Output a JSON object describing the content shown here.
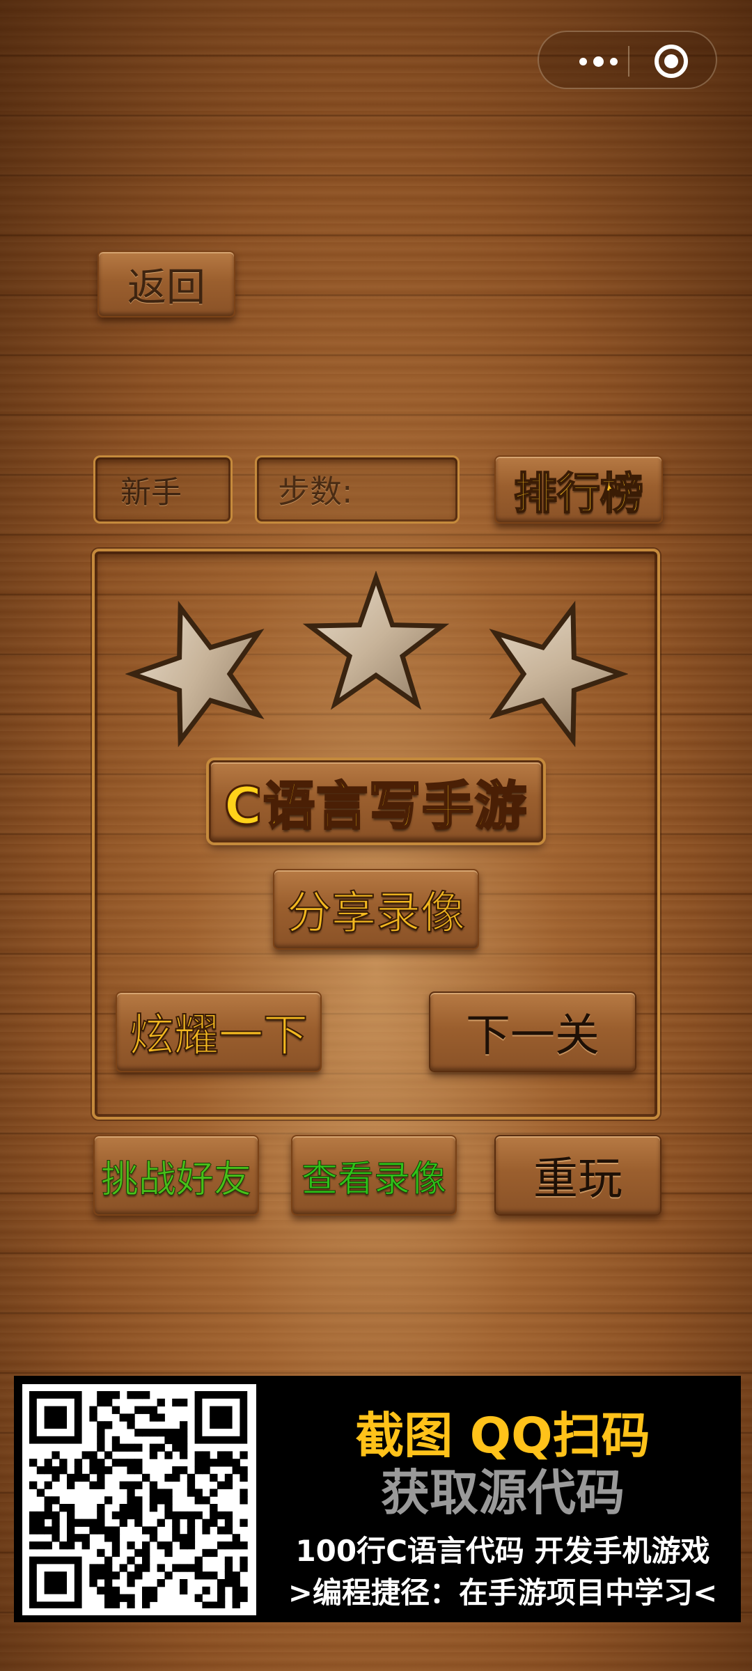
{
  "capsule": {
    "more_icon": "more-dots-icon",
    "close_icon": "target-circle-icon"
  },
  "buttons": {
    "back": "返回",
    "rank": "排行榜",
    "share_replay": "分享录像",
    "show_off": "炫耀一下",
    "next_level": "下一关",
    "challenge_friend": "挑战好友",
    "view_replay": "查看录像",
    "replay": "重玩"
  },
  "status": {
    "difficulty": "新手",
    "steps_label": "步数:",
    "steps_value": ""
  },
  "result": {
    "stars_earned": 3,
    "stars_total": 3,
    "title": "C语言写手游"
  },
  "banner": {
    "line1": "截图 QQ扫码",
    "line2": "获取源代码",
    "line3": "100行C语言代码 开发手机游戏",
    "line4": ">编程捷径：在手游项目中学习<"
  },
  "colors": {
    "title_yellow": "#ffd21a",
    "rank_gold": "#f2b820",
    "green_text": "#48c01a",
    "banner_yellow": "#ffc21a",
    "banner_gray": "#9a9a9a"
  }
}
